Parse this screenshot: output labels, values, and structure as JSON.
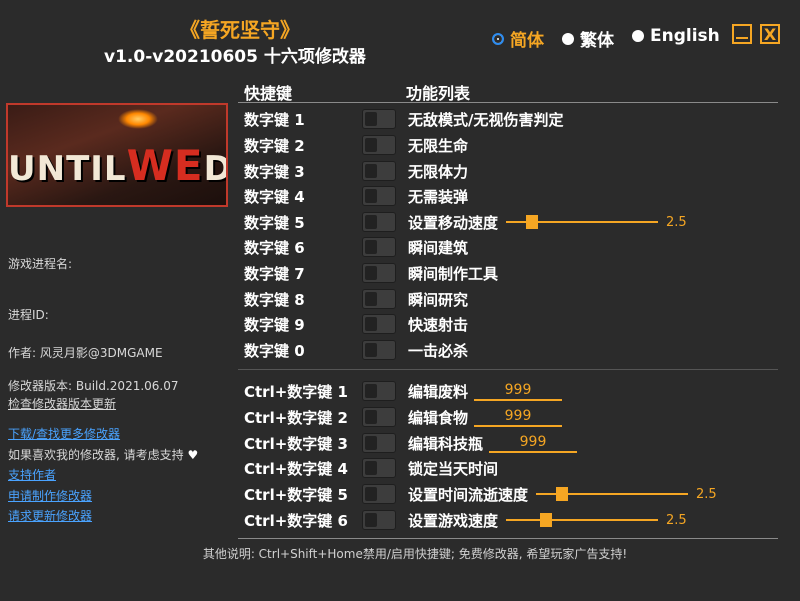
{
  "header": {
    "title": "《誓死坚守》",
    "subtitle": "v1.0-v20210605 十六项修改器"
  },
  "languages": [
    {
      "label": "简体",
      "selected": true
    },
    {
      "label": "繁体",
      "selected": false
    },
    {
      "label": "English",
      "selected": false
    }
  ],
  "window_buttons": {
    "minimize_icon": "minimize-icon",
    "close_label": "X"
  },
  "cover": {
    "text_until": "UNTIL",
    "text_we": "WE",
    "text_die": "DIE"
  },
  "sidebar": {
    "process_name": "游戏进程名:",
    "process_id": "进程ID:",
    "author": "作者: 风灵月影@3DMGAME",
    "version": "修改器版本: Build.2021.06.07",
    "check_update": "检查修改器版本更新",
    "download_more": "下载/查找更多修改器",
    "support_text": "如果喜欢我的修改器, 请考虑支持",
    "support_author": "支持作者",
    "request_trainer": "申请制作修改器",
    "request_update": "请求更新修改器"
  },
  "columns": {
    "hotkey": "快捷键",
    "function_list": "功能列表"
  },
  "rows": [
    {
      "key": "数字键 1",
      "func": "无敌模式/无视伤害判定"
    },
    {
      "key": "数字键 2",
      "func": "无限生命"
    },
    {
      "key": "数字键 3",
      "func": "无限体力"
    },
    {
      "key": "数字键 4",
      "func": "无需装弹"
    },
    {
      "key": "数字键 5",
      "func": "设置移动速度",
      "value": "2.5"
    },
    {
      "key": "数字键 6",
      "func": "瞬间建筑"
    },
    {
      "key": "数字键 7",
      "func": "瞬间制作工具"
    },
    {
      "key": "数字键 8",
      "func": "瞬间研究"
    },
    {
      "key": "数字键 9",
      "func": "快速射击"
    },
    {
      "key": "数字键 0",
      "func": "一击必杀"
    },
    {
      "key": "Ctrl+数字键 1",
      "func": "编辑废料",
      "value": "999"
    },
    {
      "key": "Ctrl+数字键 2",
      "func": "编辑食物",
      "value": "999"
    },
    {
      "key": "Ctrl+数字键 3",
      "func": "编辑科技瓶",
      "value": "999"
    },
    {
      "key": "Ctrl+数字键 4",
      "func": "锁定当天时间"
    },
    {
      "key": "Ctrl+数字键 5",
      "func": "设置时间流逝速度",
      "value": "2.5"
    },
    {
      "key": "Ctrl+数字键 6",
      "func": "设置游戏速度",
      "value": "2.5"
    }
  ],
  "footer": "其他说明: Ctrl+Shift+Home禁用/启用快捷键; 免费修改器, 希望玩家广告支持!",
  "colors": {
    "accent": "#f5a623",
    "background": "#2b2b2b",
    "link": "#4aa3ff",
    "selected_radio": "#2d8cf0"
  }
}
